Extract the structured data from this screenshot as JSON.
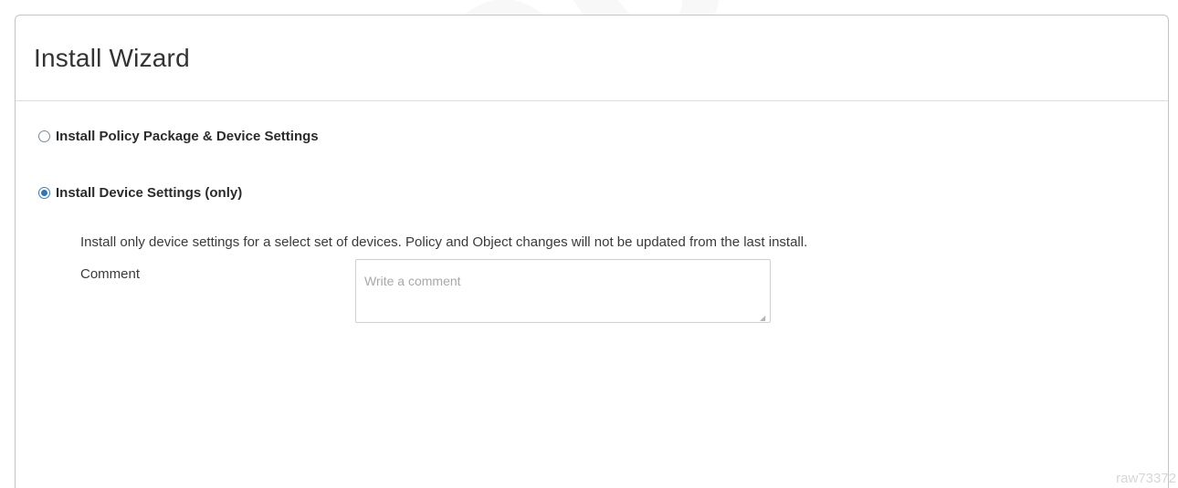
{
  "wizard": {
    "title": "Install Wizard",
    "options": [
      {
        "label": "Install Policy Package & Device Settings",
        "selected": false
      },
      {
        "label": "Install Device Settings (only)",
        "selected": true
      }
    ],
    "description": "Install only device settings for a select set of devices. Policy and Object changes will not be updated from the last install.",
    "comment": {
      "label": "Comment",
      "value": "",
      "placeholder": "Write a comment"
    }
  },
  "watermark": {
    "text": "prepa",
    "corner_text": "raw73372"
  },
  "colors": {
    "accent": "#2f74bf",
    "border": "#c4c4c4",
    "text": "#333333"
  }
}
